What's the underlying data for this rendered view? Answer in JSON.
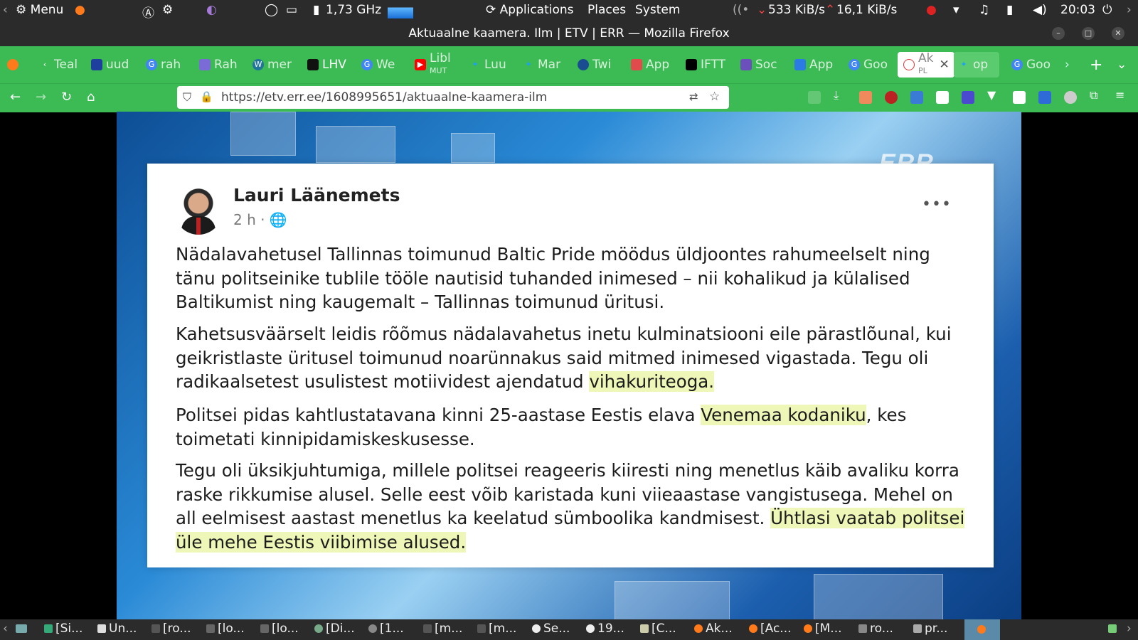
{
  "system_panel": {
    "menu": "Menu",
    "cpu_freq": "1,73 GHz",
    "applications": "Applications",
    "places": "Places",
    "system": "System",
    "download_speed": "533 KiB/s",
    "upload_speed": "16,1 KiB/s",
    "clock": "20:03"
  },
  "window": {
    "title": "Aktuaalne kaamera. Ilm | ETV | ERR — Mozilla Firefox"
  },
  "tabs": [
    {
      "label": "Teal",
      "icon": "chevron-left"
    },
    {
      "label": "uud",
      "color": "#1f3f9f"
    },
    {
      "label": "rah",
      "color": "#4285f4"
    },
    {
      "label": "Rah",
      "color": "#7a6bd6"
    },
    {
      "label": "mer",
      "color": "#21759b"
    },
    {
      "label": "LHV",
      "color": "#111111"
    },
    {
      "label": "We",
      "color": "#4285f4"
    },
    {
      "label": "Libl",
      "sub": "MUT",
      "color": "#ff0000"
    },
    {
      "label": "Luu",
      "color": "#1da1f2"
    },
    {
      "label": "Mar",
      "color": "#1da1f2"
    },
    {
      "label": "Twi",
      "color": "#1a4d8f"
    },
    {
      "label": "App",
      "color": "#e24b4b"
    },
    {
      "label": "IFTT",
      "color": "#000000"
    },
    {
      "label": "Soc",
      "color": "#6b4fbb"
    },
    {
      "label": "App",
      "color": "#2c7be5"
    },
    {
      "label": "Goo",
      "color": "#4285f4"
    },
    {
      "label": "Ak",
      "sub": "PL",
      "active": true
    },
    {
      "label": "op",
      "color": "#1da1f2"
    },
    {
      "label": "Goo",
      "color": "#4285f4"
    }
  ],
  "nav": {
    "url": "https://etv.err.ee/1608995651/aktuaalne-kaamera-ilm"
  },
  "post": {
    "author": "Lauri Läänemets",
    "time": "2 h ·",
    "watermark": "ERR",
    "p1": "Nädalavahetusel Tallinnas toimunud Baltic Pride möödus üldjoontes rahumeelselt ning tänu politseinike tublile tööle nautisid tuhanded inimesed – nii kohalikud ja külalised Baltikumist ning kaugemalt –  Tallinnas toimunud üritusi.",
    "p2_a": "Kahetsusväärselt leidis rõõmus nädalavahetus inetu kulminatsiooni eile pärastlõunal, kui geikristlaste üritusel toimunud noarünnakus said mitmed inimesed vigastada. Tegu oli radikaalsetest usulistest motiividest ajendatud ",
    "p2_hl": "vihakuriteoga.",
    "p3_a": "Politsei pidas kahtlustatavana kinni 25-aastase Eestis elava ",
    "p3_hl": "Venemaa kodaniku",
    "p3_b": ", kes toimetati kinnipidamiskeskusesse.",
    "p4_a": "Tegu oli üksikjuhtumiga, millele politsei reageeris kiiresti ning menetlus käib avaliku korra raske rikkumise alusel. Selle eest võib karistada kuni viieaastase vangistusega. Mehel on all eelmisest aastast menetlus ka keelatud sümboolika kandmisest. ",
    "p4_hl": "Ühtlasi vaatab politsei üle mehe Eestis viibimise alused."
  },
  "taskbar": [
    {
      "label": "[Si..."
    },
    {
      "label": "Un..."
    },
    {
      "label": "[ro..."
    },
    {
      "label": "[lo..."
    },
    {
      "label": "[lo..."
    },
    {
      "label": "[Di..."
    },
    {
      "label": "[1..."
    },
    {
      "label": "[m..."
    },
    {
      "label": "[m..."
    },
    {
      "label": "Se..."
    },
    {
      "label": "19..."
    },
    {
      "label": "[C..."
    },
    {
      "label": "Ak..."
    },
    {
      "label": "[Ac..."
    },
    {
      "label": "[M..."
    },
    {
      "label": "ro..."
    },
    {
      "label": "pr..."
    }
  ]
}
